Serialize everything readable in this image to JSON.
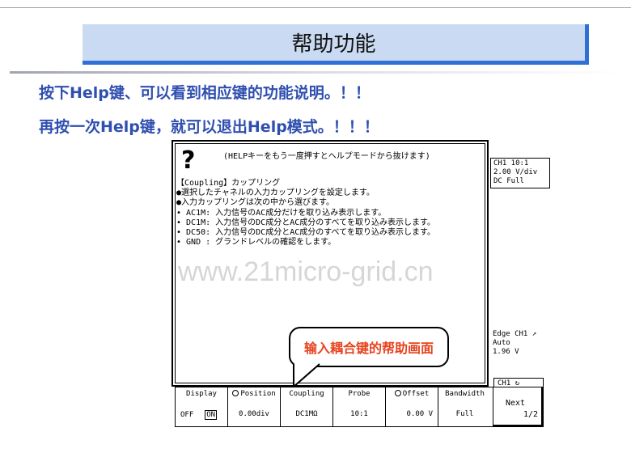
{
  "slide": {
    "title": "帮助功能",
    "instruction_1": "按下Help键、可以看到相应键的功能说明。！！",
    "instruction_2": "再按一次Help键，就可以退出Help模式。！！！",
    "callout": "输入耦合键的帮助画面"
  },
  "scope": {
    "help_icon": "question-mark-icon",
    "help_exit_hint": "(HELPキーをもう一度押すとヘルプモードから抜けます)",
    "help_lines": [
      "【Coupling】カップリング",
      "●選択したチャネルの入力カップリングを設定します。",
      "●入力カップリングは次の中から選びます。",
      "  • AC1M: 入力信号のAC成分だけを取り込み表示します。",
      "  • DC1M: 入力信号のDC成分とAC成分のすべてを取り込み表示します。",
      "  • DC50: 入力信号のDC成分とAC成分のすべてを取り込み表示します。",
      "  • GND : グランドレベルの確認をします。"
    ],
    "watermark": "www.21micro-grid.cn",
    "channel_info": [
      "CH1 10:1",
      "2.00 V/div",
      "DC    Full"
    ],
    "trigger_info": [
      "Edge CH1 ↗",
      "Auto",
      "1.96 V"
    ],
    "channel_tag": "CH1"
  },
  "menu": {
    "items": [
      {
        "label": "Display",
        "value": "OFF",
        "value2": "ON"
      },
      {
        "label": "Position",
        "value": "0.00div"
      },
      {
        "label": "Coupling",
        "value": "DC1MΩ"
      },
      {
        "label": "Probe",
        "value": "10:1"
      },
      {
        "label": "Offset",
        "value": "0.00 V"
      },
      {
        "label": "Bandwidth",
        "value": "Full"
      }
    ],
    "next_label": "Next",
    "next_page": "1/2"
  }
}
